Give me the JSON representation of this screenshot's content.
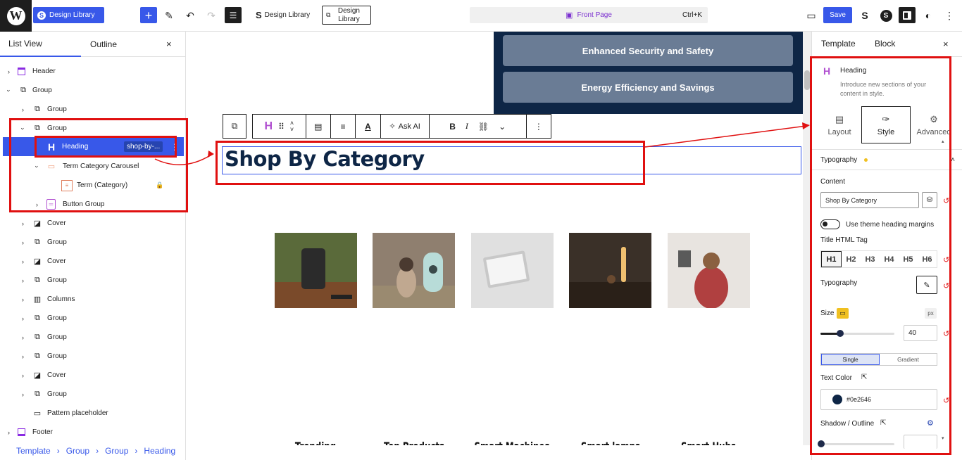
{
  "topbar": {
    "logo_glyph": "W",
    "design_library_label": "Design Library",
    "design_library_tool_label": "Design Library",
    "design_library_tool2_label": "Design Library",
    "command_label": "Front Page",
    "command_shortcut": "Ctrl+K",
    "save_label": "Save",
    "icons": [
      "wordpress-icon",
      "plus-icon",
      "pencil-icon",
      "undo-icon",
      "redo-icon",
      "document-overview-icon",
      "stackable-icon",
      "view-desktop-icon",
      "stackable-s-icon",
      "spectra-icon",
      "settings-icon",
      "styles-icon",
      "options-icon"
    ]
  },
  "left_panel": {
    "tab_list": "List View",
    "tab_outline": "Outline",
    "close_glyph": "×",
    "tree": [
      {
        "label": "Header",
        "icon": "template-part-icon"
      },
      {
        "label": "Group",
        "icon": "group-icon"
      },
      {
        "label": "Group",
        "icon": "group-icon"
      },
      {
        "label": "Group",
        "icon": "group-icon"
      },
      {
        "label": "Heading",
        "icon": "heading-icon",
        "badge": "shop-by-..."
      },
      {
        "label": "Term Category Carousel",
        "icon": "carousel-icon"
      },
      {
        "label": "Term (Category)",
        "icon": "term-icon"
      },
      {
        "label": "Button Group",
        "icon": "button-group-icon"
      },
      {
        "label": "Cover",
        "icon": "cover-icon"
      },
      {
        "label": "Group",
        "icon": "group-icon"
      },
      {
        "label": "Cover",
        "icon": "cover-icon"
      },
      {
        "label": "Group",
        "icon": "group-icon"
      },
      {
        "label": "Columns",
        "icon": "columns-icon"
      },
      {
        "label": "Group",
        "icon": "group-icon"
      },
      {
        "label": "Group",
        "icon": "group-icon"
      },
      {
        "label": "Group",
        "icon": "group-icon"
      },
      {
        "label": "Cover",
        "icon": "cover-icon"
      },
      {
        "label": "Group",
        "icon": "group-icon"
      },
      {
        "label": "Pattern placeholder",
        "icon": "pattern-icon"
      },
      {
        "label": "Footer",
        "icon": "template-part-icon"
      }
    ],
    "breadcrumb": [
      "Template",
      "Group",
      "Group",
      "Heading"
    ]
  },
  "canvas": {
    "features": [
      "Enhanced Security and Safety",
      "Energy Efficiency and Savings"
    ],
    "toolbar": {
      "ask_ai": "Ask AI",
      "bold": "B",
      "italic": "I"
    },
    "heading": "Shop By Category",
    "categories": [
      "Trending",
      "Top Products",
      "Smart Machines",
      "Smart lamps",
      "Smart Hubs"
    ]
  },
  "right_panel": {
    "tab_template": "Template",
    "tab_block": "Block",
    "close_glyph": "×",
    "block_title": "Heading",
    "block_desc": "Introduce new sections of your content in style.",
    "subtabs": [
      "Layout",
      "Style",
      "Advanced"
    ],
    "section_typography": "Typography",
    "content_label": "Content",
    "content_value": "Shop By Category",
    "theme_margins_label": "Use theme heading margins",
    "title_tag_label": "Title HTML Tag",
    "tags": [
      "H1",
      "H2",
      "H3",
      "H4",
      "H5",
      "H6"
    ],
    "active_tag": "H1",
    "typography_label": "Typography",
    "size_label": "Size",
    "size_unit": "px",
    "size_value": "40",
    "size_slider_fraction": 0.27,
    "color_mode_single": "Single",
    "color_mode_gradient": "Gradient",
    "text_color_label": "Text Color",
    "text_color_value": "#0e2646",
    "shadow_label": "Shadow / Outline"
  },
  "colors": {
    "accent": "#3858e9",
    "dark_navy": "#0e2646",
    "annotation_red": "#e01010",
    "badge_yellow": "#f0c020"
  }
}
